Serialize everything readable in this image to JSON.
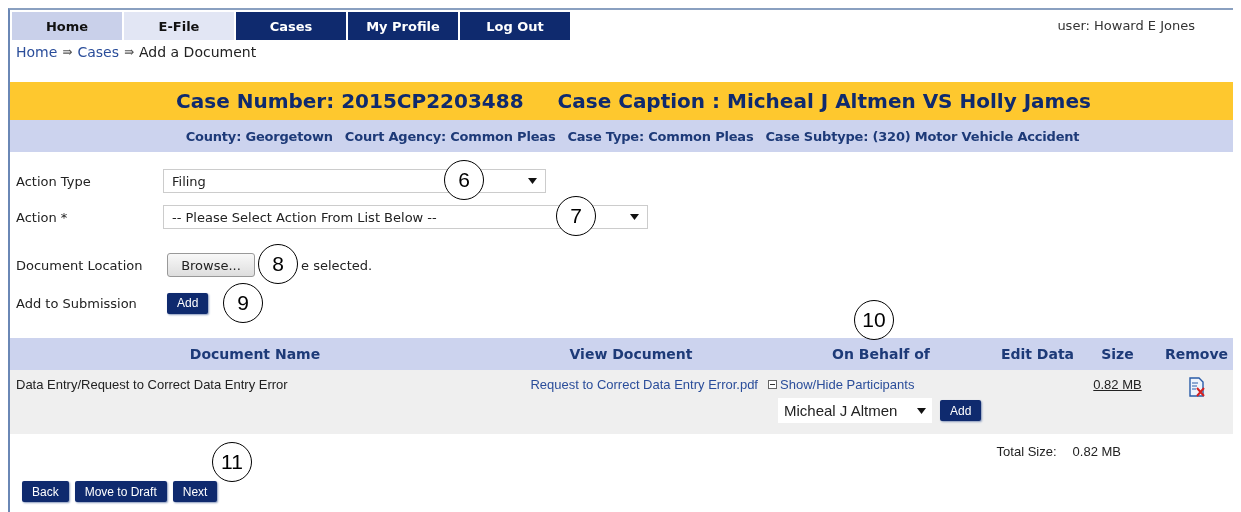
{
  "nav": {
    "tabs": [
      {
        "label": "Home",
        "highlighted": true,
        "selected": false
      },
      {
        "label": "E-File",
        "highlighted": true,
        "selected": true
      },
      {
        "label": "Cases",
        "highlighted": false,
        "selected": false
      },
      {
        "label": "My Profile",
        "highlighted": false,
        "selected": false
      },
      {
        "label": "Log Out",
        "highlighted": false,
        "selected": false
      }
    ],
    "user": "user: Howard E Jones"
  },
  "breadcrumb": {
    "separator": "⇛",
    "items": [
      {
        "label": "Home",
        "link": true
      },
      {
        "label": "Cases",
        "link": true
      },
      {
        "label": "Add a Document",
        "link": false
      }
    ]
  },
  "banner": {
    "case_number": "Case Number: 2015CP2203488",
    "caption": "Case Caption : Micheal J Altmen VS Holly James"
  },
  "details": [
    "County: Georgetown",
    "Court Agency: Common Pleas",
    "Case Type: Common Pleas",
    "Case Subtype: (320) Motor Vehicle Accident"
  ],
  "form": {
    "action_type": {
      "label": "Action Type",
      "value": "Filing",
      "callout": "6"
    },
    "action": {
      "label": "Action *",
      "value": "-- Please Select Action From List Below --",
      "callout": "7"
    },
    "document_location": {
      "label": "Document Location",
      "button": "Browse...",
      "status": "e selected.",
      "callout": "8"
    },
    "add_to_submission": {
      "label": "Add to Submission",
      "button": "Add",
      "callout": "9"
    }
  },
  "table": {
    "callout": "10",
    "columns": [
      "Document Name",
      "View Document",
      "On Behalf of",
      "Edit Data",
      "Size",
      "Remove"
    ],
    "rows": [
      {
        "document_name": "Data Entry/Request to Correct Data Entry Error",
        "view_document": "Request to Correct Data Entry Error.pdf",
        "toggle": "Show/Hide Participants",
        "expanded": true,
        "participant": "Micheal J Altmen",
        "add_button": "Add",
        "size": "0.82 MB"
      }
    ],
    "total_label": "Total Size:",
    "total_value": "0.82 MB"
  },
  "footer": {
    "callout": "11",
    "buttons": [
      "Back",
      "Move to Draft",
      "Next"
    ]
  }
}
